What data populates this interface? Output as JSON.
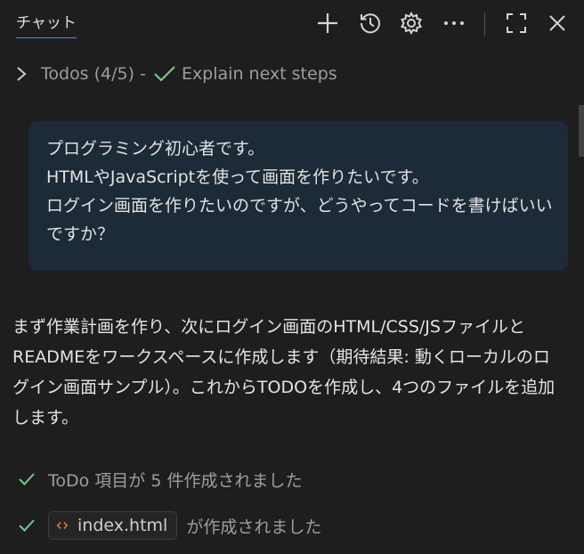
{
  "header": {
    "tab_label": "チャット",
    "icons": [
      "plus-icon",
      "history-icon",
      "gear-icon",
      "more-icon",
      "maximize-icon",
      "close-icon"
    ]
  },
  "todos": {
    "summary": "Todos (4/5) -",
    "current_item": "Explain next steps"
  },
  "user_message": {
    "lines": [
      "プログラミング初心者です。",
      "HTMLやJavaScriptを使って画面を作りたいです。",
      "ログイン画面を作りたいのですが、どうやってコードを書けばいい",
      "ですか？"
    ]
  },
  "assistant_message": {
    "lines": [
      "まず作業計画を作り、次にログイン画面のHTML/CSS/JSファイルと",
      "READMEをワークスペースに作成します（期待結果: 動くローカルのロ",
      "グイン画面サンプル）。これからTODOを作成し、4つのファイルを追加",
      "します。"
    ]
  },
  "status": {
    "todo_created": "ToDo 項目が 5 件作成されました",
    "file_name": "index.html",
    "file_created_suffix": "が作成されました"
  },
  "colors": {
    "background": "#1e1e1e",
    "bubble": "#1d2a37",
    "check_green": "#73c991",
    "accent_blue": "#3794ff",
    "file_icon_orange": "#e37933"
  }
}
